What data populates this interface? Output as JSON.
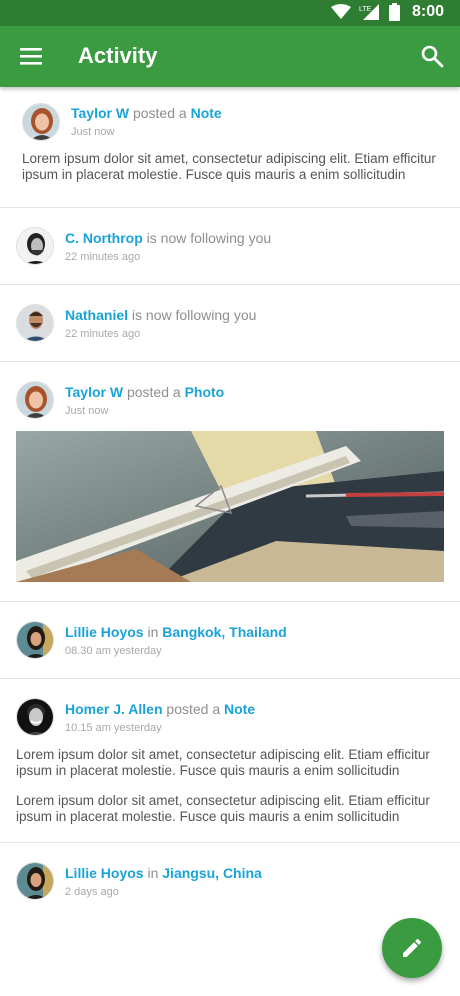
{
  "status_bar": {
    "time": "8:00",
    "network": "LTE"
  },
  "app_bar": {
    "title": "Activity"
  },
  "feed": [
    {
      "user": "Taylor W",
      "verb": "posted a",
      "object": "Note",
      "time": "Just now",
      "text": "Lorem ipsum dolor sit amet, consectetur adipiscing elit. Etiam efficitur ipsum in placerat molestie.  Fusce quis mauris a enim sollicitudin"
    },
    {
      "user": "C. Northrop",
      "verb": "is now following you",
      "time": "22 minutes ago"
    },
    {
      "user": "Nathaniel",
      "verb": "is now following you",
      "time": "22 minutes ago"
    },
    {
      "user": "Taylor W",
      "verb": "posted a",
      "object": "Photo",
      "time": "Just now"
    },
    {
      "user": "Lillie Hoyos",
      "verb": "in",
      "object": "Bangkok, Thailand",
      "time": "08.30 am yesterday"
    },
    {
      "user": "Homer J. Allen",
      "verb": "posted a",
      "object": "Note",
      "time": "10.15 am yesterday",
      "text": "Lorem ipsum dolor sit amet, consectetur adipiscing elit. Etiam efficitur ipsum in placerat molestie.  Fusce quis mauris a enim sollicitudin",
      "text2": "Lorem ipsum dolor sit amet, consectetur adipiscing elit. Etiam efficitur ipsum in placerat molestie.  Fusce quis mauris a enim sollicitudin"
    },
    {
      "user": "Lillie Hoyos",
      "verb": "in",
      "object": "Jiangsu, China",
      "time": "2 days ago"
    }
  ],
  "icons": {
    "menu": "menu-icon",
    "search": "search-icon",
    "fab": "edit-icon"
  },
  "colors": {
    "app_bar": "#3b9b40",
    "status_bar": "#2e7d32",
    "link": "#1aa3d9"
  }
}
